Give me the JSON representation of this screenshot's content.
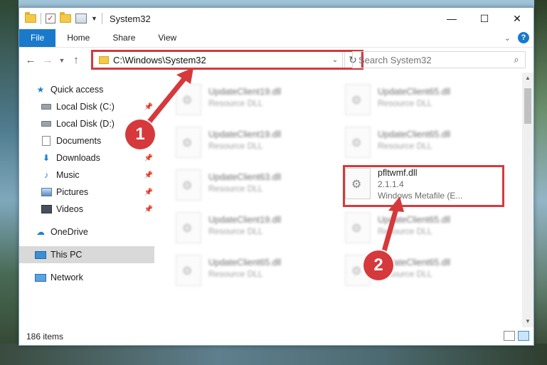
{
  "window": {
    "title": "System32",
    "controls": {
      "minimize": "—",
      "maximize": "☐",
      "close": "✕"
    }
  },
  "ribbon": {
    "tabs": [
      "File",
      "Home",
      "Share",
      "View"
    ],
    "help": "?"
  },
  "address": {
    "path": "C:\\Windows\\System32",
    "search_placeholder": "Search System32"
  },
  "sidebar": {
    "quick_access": "Quick access",
    "items": [
      {
        "label": "Local Disk (C:)",
        "icon": "disk-icon",
        "pinned": true
      },
      {
        "label": "Local Disk (D:)",
        "icon": "disk-icon",
        "pinned": true
      },
      {
        "label": "Documents",
        "icon": "documents-icon",
        "pinned": true
      },
      {
        "label": "Downloads",
        "icon": "downloads-icon",
        "pinned": true
      },
      {
        "label": "Music",
        "icon": "music-icon",
        "pinned": true
      },
      {
        "label": "Pictures",
        "icon": "pictures-icon",
        "pinned": true
      },
      {
        "label": "Videos",
        "icon": "videos-icon",
        "pinned": true
      }
    ],
    "onedrive": "OneDrive",
    "this_pc": "This PC",
    "network": "Network"
  },
  "files": [
    {
      "name": "UpdateClient19.dll",
      "type": "Resource DLL",
      "blurred": true
    },
    {
      "name": "UpdateClient65.dll",
      "type": "Resource DLL",
      "blurred": true
    },
    {
      "name": "UpdateClient19.dll",
      "type": "Resource DLL",
      "blurred": true
    },
    {
      "name": "UpdateClient65.dll",
      "type": "Resource DLL",
      "blurred": true
    },
    {
      "name": "UpdateClient63.dll",
      "type": "Resource DLL",
      "blurred": true
    },
    {
      "name": "pfltwmf.dll",
      "version": "2.1.1.4",
      "description": "Windows Metafile (E...",
      "blurred": false
    },
    {
      "name": "UpdateClient19.dll",
      "type": "Resource DLL",
      "blurred": true
    },
    {
      "name": "UpdateClient65.dll",
      "type": "Resource DLL",
      "blurred": true
    },
    {
      "name": "UpdateClient65.dll",
      "type": "Resource DLL",
      "blurred": true
    },
    {
      "name": "UpdateClient65.dll",
      "type": "Resource DLL",
      "blurred": true
    }
  ],
  "status": {
    "item_count": "186 items"
  },
  "callouts": {
    "one": "1",
    "two": "2"
  },
  "colors": {
    "accent": "#1979ca",
    "highlight": "#d6393c"
  }
}
